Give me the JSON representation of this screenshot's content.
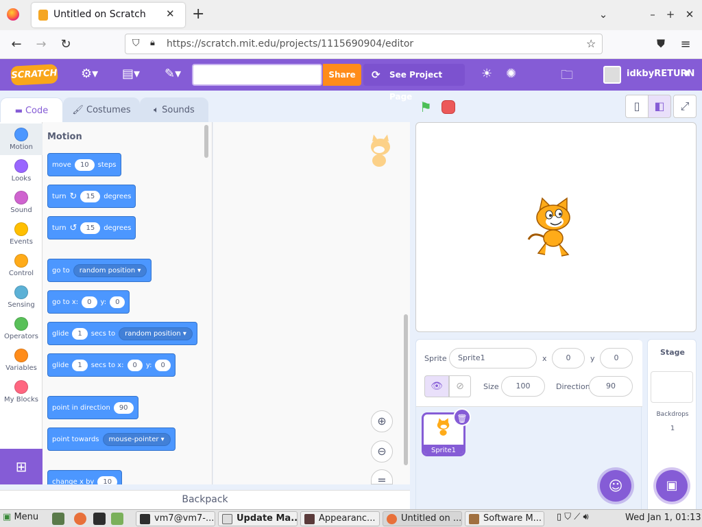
{
  "browser": {
    "tab_title": "Untitled on Scratch",
    "tab_close": "✕",
    "new_tab": "+",
    "url": "https://scratch.mit.edu/projects/1115690904/editor",
    "window_controls": {
      "list": "⌄",
      "minimize": "–",
      "maximize": "+",
      "close": "✕"
    }
  },
  "menubar": {
    "logo": "SCRATCH",
    "title_value": "",
    "share_label": "Share",
    "see_project_label": "See Project Page",
    "username": "idkbyRETURN"
  },
  "editor_tabs": [
    "Code",
    "Costumes",
    "Sounds"
  ],
  "categories": [
    {
      "label": "Motion",
      "color": "#4c97ff"
    },
    {
      "label": "Looks",
      "color": "#9966ff"
    },
    {
      "label": "Sound",
      "color": "#cf63cf"
    },
    {
      "label": "Events",
      "color": "#ffbf00"
    },
    {
      "label": "Control",
      "color": "#ffab19"
    },
    {
      "label": "Sensing",
      "color": "#5cb1d6"
    },
    {
      "label": "Operators",
      "color": "#59c059"
    },
    {
      "label": "Variables",
      "color": "#ff8c1a"
    },
    {
      "label": "My Blocks",
      "color": "#ff6680"
    }
  ],
  "palette": {
    "heading": "Motion",
    "move": {
      "pre": "move",
      "value": "10",
      "post": "steps"
    },
    "turn_right": {
      "pre": "turn",
      "value": "15",
      "post": "degrees"
    },
    "turn_left": {
      "pre": "turn",
      "value": "15",
      "post": "degrees"
    },
    "go_to": {
      "pre": "go to",
      "option": "random position"
    },
    "go_to_xy": {
      "pre": "go to x:",
      "x": "0",
      "ylabel": "y:",
      "y": "0"
    },
    "glide_to": {
      "pre": "glide",
      "value": "1",
      "mid": "secs to",
      "option": "random position"
    },
    "glide_xy": {
      "pre": "glide",
      "value": "1",
      "mid": "secs to x:",
      "x": "0",
      "ylabel": "y:",
      "y": "0"
    },
    "point_direction": {
      "pre": "point in direction",
      "value": "90"
    },
    "point_towards": {
      "pre": "point towards",
      "option": "mouse-pointer"
    },
    "change_x": {
      "pre": "change x by",
      "value": "10"
    }
  },
  "backpack_label": "Backpack",
  "sprite_info": {
    "sprite_label": "Sprite",
    "sprite_name": "Sprite1",
    "x_label": "x",
    "x_value": "0",
    "y_label": "y",
    "y_value": "0",
    "size_label": "Size",
    "size_value": "100",
    "direction_label": "Direction",
    "direction_value": "90"
  },
  "sprite_tile_name": "Sprite1",
  "stage_pane": {
    "title": "Stage",
    "backdrops_label": "Backdrops",
    "backdrops_count": "1"
  },
  "taskbar": {
    "menu_label": "Menu",
    "tasks": [
      "vm7@vm7-...",
      "Update Ma...",
      "Appearanc...",
      "Untitled on ...",
      "Software M..."
    ],
    "clock": "Wed Jan  1, 01:13"
  }
}
